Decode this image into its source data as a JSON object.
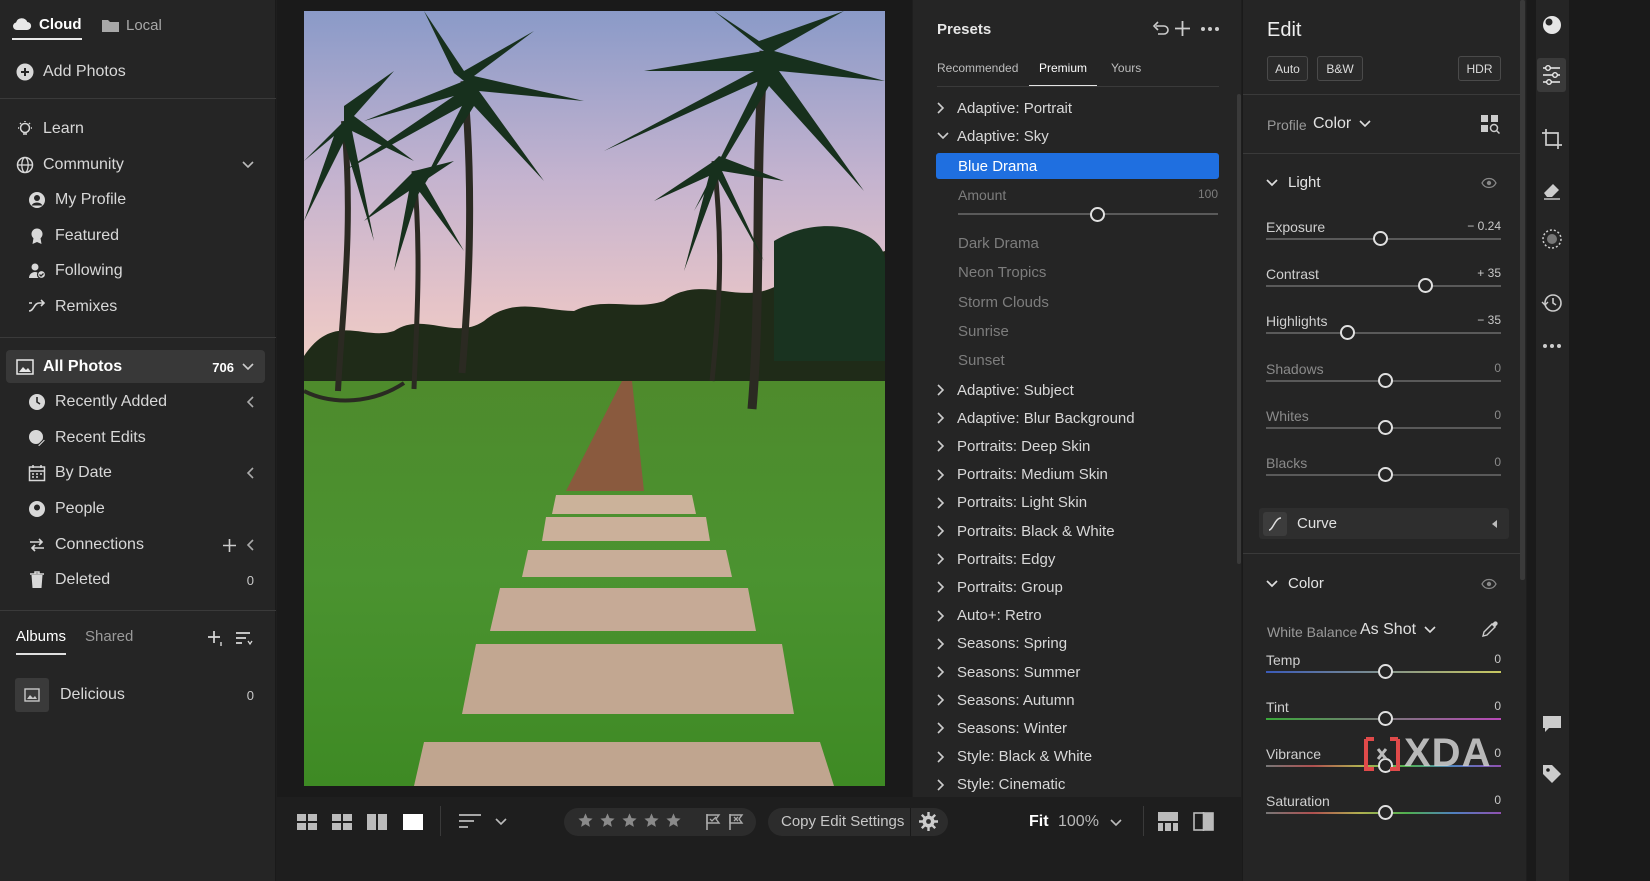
{
  "left": {
    "tabs": [
      {
        "label": "Cloud"
      },
      {
        "label": "Local"
      }
    ],
    "add_photos": "Add Photos",
    "learn": "Learn",
    "community": "Community",
    "community_items": [
      "My Profile",
      "Featured",
      "Following",
      "Remixes"
    ],
    "all_photos": {
      "label": "All Photos",
      "count": "706"
    },
    "photo_items": [
      {
        "label": "Recently Added"
      },
      {
        "label": "Recent Edits"
      },
      {
        "label": "By Date"
      },
      {
        "label": "People"
      },
      {
        "label": "Connections"
      },
      {
        "label": "Deleted",
        "count": "0"
      }
    ],
    "albums_tab": "Albums",
    "shared_tab": "Shared",
    "albums": [
      {
        "label": "Delicious",
        "count": "0"
      }
    ]
  },
  "presets": {
    "title": "Presets",
    "tabs": [
      "Recommended",
      "Premium",
      "Yours"
    ],
    "groups_top": [
      "Adaptive: Portrait",
      "Adaptive: Sky"
    ],
    "selected": "Blue Drama",
    "amount_label": "Amount",
    "amount_value": "100",
    "amount_fraction": 0.54,
    "sky_items": [
      "Dark Drama",
      "Neon Tropics",
      "Storm Clouds",
      "Sunrise",
      "Sunset"
    ],
    "groups": [
      "Adaptive: Subject",
      "Adaptive: Blur Background",
      "Portraits: Deep Skin",
      "Portraits: Medium Skin",
      "Portraits: Light Skin",
      "Portraits: Black & White",
      "Portraits: Edgy",
      "Portraits: Group",
      "Auto+: Retro",
      "Seasons: Spring",
      "Seasons: Summer",
      "Seasons: Autumn",
      "Seasons: Winter",
      "Style: Black & White",
      "Style: Cinematic"
    ]
  },
  "edit": {
    "title": "Edit",
    "auto": "Auto",
    "bw": "B&W",
    "hdr": "HDR",
    "profile_label": "Profile",
    "profile_value": "Color",
    "light_title": "Light",
    "light_sliders": [
      {
        "label": "Exposure",
        "value": "− 0.24",
        "pos": 0.49,
        "dim": false
      },
      {
        "label": "Contrast",
        "value": "+ 35",
        "pos": 0.68,
        "dim": false
      },
      {
        "label": "Highlights",
        "value": "− 35",
        "pos": 0.35,
        "dim": false
      },
      {
        "label": "Shadows",
        "value": "0",
        "pos": 0.51,
        "dim": true
      },
      {
        "label": "Whites",
        "value": "0",
        "pos": 0.51,
        "dim": true
      },
      {
        "label": "Blacks",
        "value": "0",
        "pos": 0.51,
        "dim": true
      }
    ],
    "curve_label": "Curve",
    "color_title": "Color",
    "wb_label": "White Balance",
    "wb_value": "As Shot",
    "color_sliders": [
      {
        "label": "Temp",
        "value": "0",
        "pos": 0.51
      },
      {
        "label": "Tint",
        "value": "0",
        "pos": 0.51
      },
      {
        "label": "Vibrance",
        "value": "0",
        "pos": 0.51
      },
      {
        "label": "Saturation",
        "value": "0",
        "pos": 0.51
      }
    ]
  },
  "bottom": {
    "copy_edit": "Copy Edit Settings",
    "fit": "Fit",
    "zoom": "100%",
    "star_count": 5
  },
  "watermark": "XDA",
  "colors": {
    "accent": "#1f6fe0",
    "bg": "#252525",
    "dark": "#1a1a1a"
  }
}
